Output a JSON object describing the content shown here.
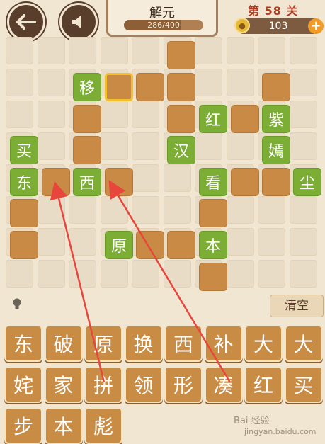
{
  "header": {
    "title": "解元",
    "progress_text": "286/400",
    "progress_fraction": 0.715,
    "level_text": "第 58 关",
    "coins": "103",
    "coin_plus": "+",
    "back_icon": "back-arrow-icon",
    "sound_icon": "speaker-icon"
  },
  "board": {
    "green_tiles": [
      "移",
      "红",
      "紫",
      "买",
      "汉",
      "嫣",
      "东",
      "西",
      "看",
      "尘",
      "原",
      "本"
    ],
    "selected_cell": "empty-selected"
  },
  "controls": {
    "clear_label": "清空",
    "hint_icon": "lightbulb-icon"
  },
  "choices": [
    "东",
    "破",
    "原",
    "换",
    "西",
    "补",
    "大",
    "大",
    "姹",
    "家",
    "拼",
    "领",
    "形",
    "凑",
    "红",
    "买",
    "步",
    "本",
    "彪"
  ],
  "watermark": {
    "text": "Bai 经验",
    "sub": "jingyan.baidu.com"
  },
  "colors": {
    "green_tile": "#7cae36",
    "brown_tile": "#c88a44",
    "arrow": "#e8453c"
  }
}
